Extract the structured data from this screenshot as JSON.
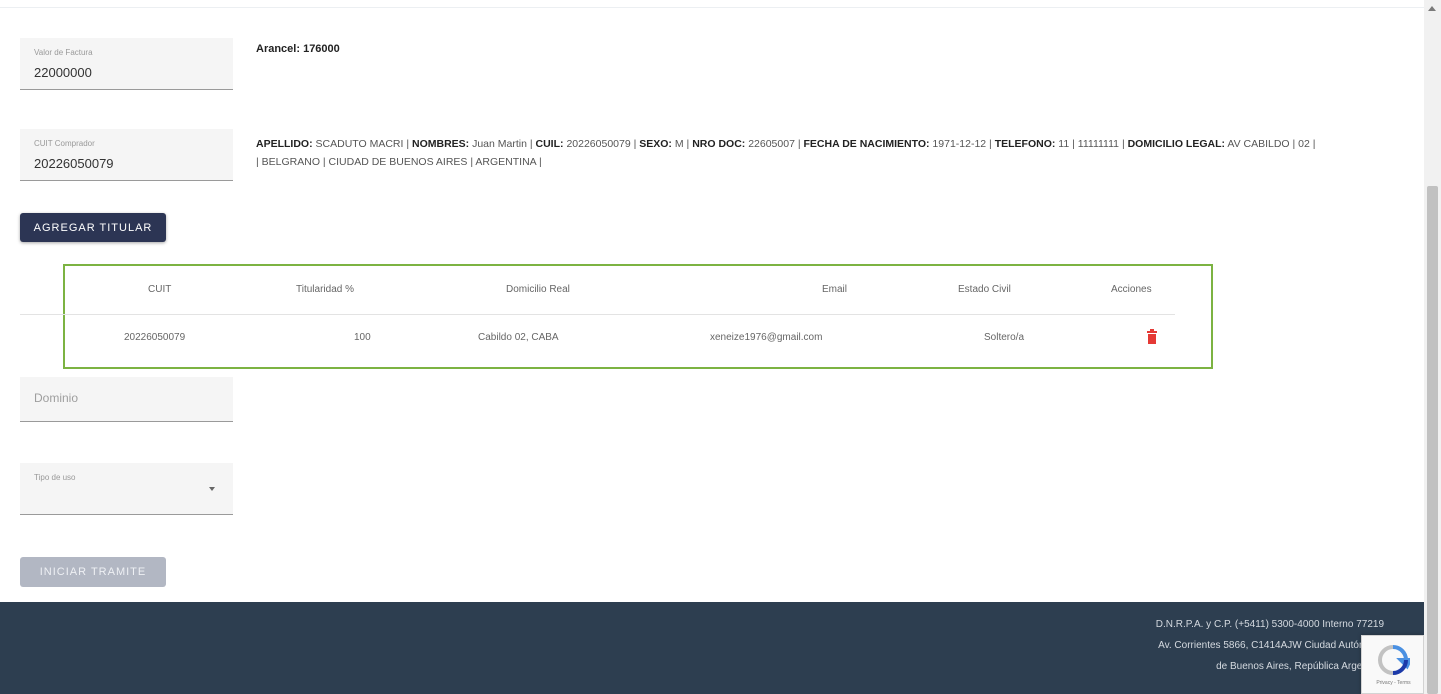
{
  "form": {
    "valor_factura": {
      "label": "Valor de Factura",
      "value": "22000000"
    },
    "arancel": "Arancel: 176000",
    "cuit_comprador": {
      "label": "CUIT Comprador",
      "value": "20226050079"
    },
    "dominio": {
      "placeholder": "Dominio"
    },
    "tipo_uso": {
      "label": "Tipo de uso"
    }
  },
  "persona": {
    "apellido_label": "APELLIDO:",
    "apellido": "SCADUTO MACRI |",
    "nombres_label": "NOMBRES:",
    "nombres": "Juan Martin |",
    "cuil_label": "CUIL:",
    "cuil": "20226050079 |",
    "sexo_label": "SEXO:",
    "sexo": "M |",
    "nro_doc_label": "NRO DOC:",
    "nro_doc": "22605007 |",
    "fecha_nac_label": "FECHA DE NACIMIENTO:",
    "fecha_nac": "1971-12-12 |",
    "telefono_label": "TELEFONO:",
    "telefono": "11 | 11111111 |",
    "domicilio_label": "DOMICILIO LEGAL:",
    "domicilio": "AV CABILDO | 02 | | BELGRANO | CIUDAD DE BUENOS AIRES | ARGENTINA |"
  },
  "buttons": {
    "agregar_titular": "AGREGAR TITULAR",
    "iniciar_tramite": "INICIAR TRAMITE"
  },
  "table": {
    "headers": {
      "cuit": "CUIT",
      "titularidad": "Titularidad %",
      "domicilio": "Domicilio Real",
      "email": "Email",
      "estado_civil": "Estado Civil",
      "acciones": "Acciones"
    },
    "rows": [
      {
        "cuit": "20226050079",
        "titularidad": "100",
        "domicilio": "Cabildo 02, CABA",
        "email": "xeneize1976@gmail.com",
        "estado_civil": "Soltero/a",
        "action_icon": "trash-icon"
      }
    ]
  },
  "footer": {
    "line1": "D.N.R.P.A. y C.P. (+5411) 5300-4000 Interno 77219",
    "line2": "Av. Corrientes 5866, C1414AJW Ciudad Autónoma",
    "line3": "de Buenos Aires, República Argentina"
  },
  "recaptcha": {
    "text": "Privacy - Terms"
  },
  "colors": {
    "primary_button": "#2c3554",
    "disabled_button": "#b2b7c3",
    "highlight_border": "#7cb342",
    "delete_icon": "#e53935",
    "footer_bg": "#2d3e50"
  }
}
